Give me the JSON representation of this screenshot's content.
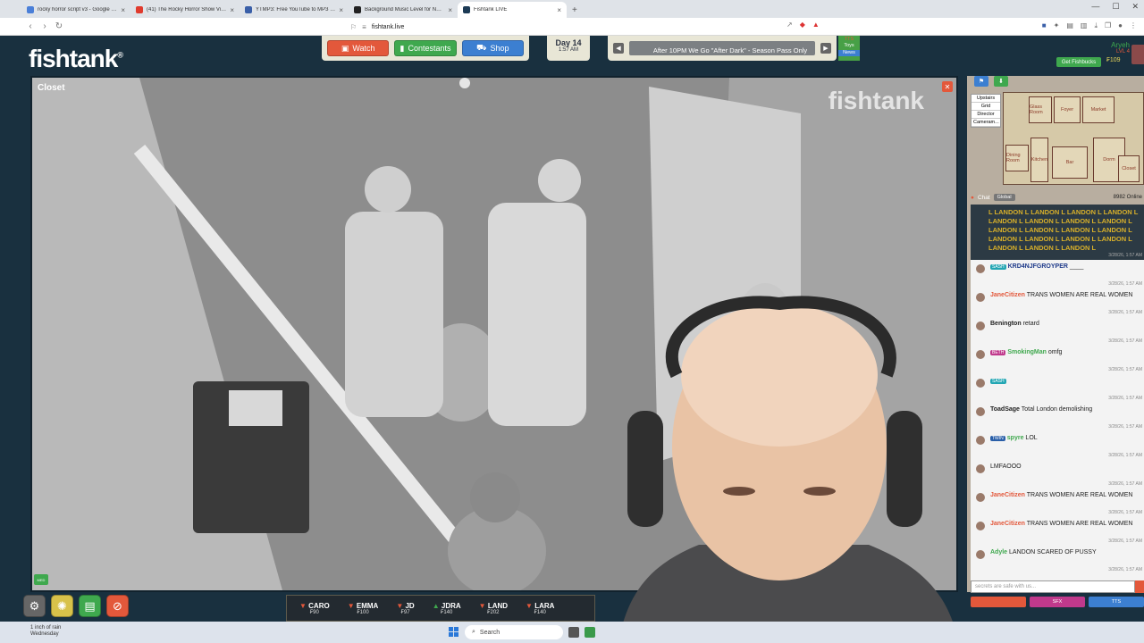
{
  "browser": {
    "tabs": [
      {
        "title": "rocky horror script v3 - Google Docs",
        "color": "#4a7fd8",
        "active": false
      },
      {
        "title": "(41) The Rocky Horror Show Video F...",
        "color": "#e03b2e",
        "active": false
      },
      {
        "title": "YTMP3: Free YouTube to MP3 Conve...",
        "color": "#3a5fa8",
        "active": false
      },
      {
        "title": "Background Music Level for Narratio...",
        "color": "#222222",
        "active": false
      },
      {
        "title": "Fishtank LIVE",
        "color": "#1c3a55",
        "active": true
      }
    ],
    "url": "fishtank.live"
  },
  "site": {
    "logo": "fishtank",
    "nav": {
      "watch": "Watch",
      "contestants": "Contestants",
      "shop": "Shop"
    },
    "day": {
      "label": "Day 14",
      "time": "1:57 AM"
    },
    "ticker": "After 10PM We Go \"After Dark\" - Season Pass Only",
    "tts": {
      "tts": "TTS",
      "toys": "Toys",
      "news": "News"
    },
    "user": {
      "name": "Aryeh",
      "level": "LVL 4",
      "fishbucks_button": "Get Fishbucks",
      "balance": "₣109"
    }
  },
  "camera": {
    "name": "Closet",
    "watermark": "fishtank",
    "med_badge": "MED"
  },
  "map": {
    "menu": [
      "Upstairs",
      "Grid",
      "Director",
      "Cameram..."
    ],
    "rooms": [
      "Glass Room",
      "Foyer",
      "Market",
      "Dining Room",
      "Kitchen",
      "Bar",
      "Dorm",
      "Closet"
    ]
  },
  "chat": {
    "title": "Chat",
    "tab": "Global",
    "online": "8982 Online",
    "spam": "L LANDON L LANDON L LANDON L LANDON L LANDON L LANDON L LANDON L LANDON L LANDON L LANDON L LANDON L LANDON L LANDON L LANDON L LANDON L LANDON L LANDON L LANDON L LANDON L",
    "spam_time": "3/28/26, 1:57 AM",
    "messages": [
      {
        "user": "KRD4NJFGROYPER",
        "text": "____",
        "badge": "SASH",
        "badge_color": "#22a6b3",
        "user_color": "#1e3a8a",
        "time": "3/28/26, 1:57 AM"
      },
      {
        "user": "JaneCitizen",
        "text": "TRANS WOMEN ARE REAL WOMEN",
        "badge": "",
        "badge_color": "",
        "user_color": "#e3583b",
        "time": "3/28/26, 1:57 AM"
      },
      {
        "user": "Benington",
        "text": "retard",
        "badge": "",
        "badge_color": "",
        "user_color": "#222222",
        "time": "3/28/26, 1:57 AM"
      },
      {
        "user": "SmokingMan",
        "text": "omfg",
        "badge": "BETH",
        "badge_color": "#c0398c",
        "user_color": "#3fa84e",
        "time": "3/28/26, 1:57 AM"
      },
      {
        "user": "",
        "text": "",
        "badge": "SASH",
        "badge_color": "#22a6b3",
        "user_color": "#7a3fc0",
        "time": "3/28/26, 1:57 AM"
      },
      {
        "user": "ToadSage",
        "text": "Total London demolishing",
        "badge": "",
        "badge_color": "",
        "user_color": "#222222",
        "time": "3/28/26, 1:57 AM"
      },
      {
        "user": "spyre",
        "text": "LOL",
        "badge": "TWIN",
        "badge_color": "#2a5fa8",
        "user_color": "#3fa84e",
        "time": "3/28/26, 1:57 AM"
      },
      {
        "user": "",
        "text": "LMFAOOO",
        "badge": "",
        "badge_color": "",
        "user_color": "#7a3fc0",
        "time": "3/28/26, 1:57 AM"
      },
      {
        "user": "JaneCitizen",
        "text": "TRANS WOMEN ARE REAL WOMEN",
        "badge": "",
        "badge_color": "",
        "user_color": "#e3583b",
        "time": "3/28/26, 1:57 AM"
      },
      {
        "user": "JaneCitizen",
        "text": "TRANS WOMEN ARE REAL WOMEN",
        "badge": "",
        "badge_color": "",
        "user_color": "#e3583b",
        "time": "3/28/26, 1:57 AM"
      },
      {
        "user": "Adyle",
        "text": "LANDON SCARED OF PUSSY",
        "badge": "",
        "badge_color": "",
        "user_color": "#3fa84e",
        "time": "3/28/26, 1:57 AM"
      }
    ],
    "input_placeholder": "secrets are safe with us...",
    "buttons": [
      "",
      "SFX",
      "TTS"
    ]
  },
  "contestants": [
    {
      "name": "CARO",
      "dir": "down",
      "value": "₣90"
    },
    {
      "name": "EMMA",
      "dir": "down",
      "value": "₣100"
    },
    {
      "name": "JD",
      "dir": "down",
      "value": "₣97"
    },
    {
      "name": "JDRA",
      "dir": "up",
      "value": "₣140"
    },
    {
      "name": "LAND",
      "dir": "down",
      "value": "₣202"
    },
    {
      "name": "LARA",
      "dir": "down",
      "value": "₣140"
    }
  ],
  "taskbar": {
    "weather_line1": "1 inch of rain",
    "weather_line2": "Wednesday",
    "search": "Search"
  }
}
